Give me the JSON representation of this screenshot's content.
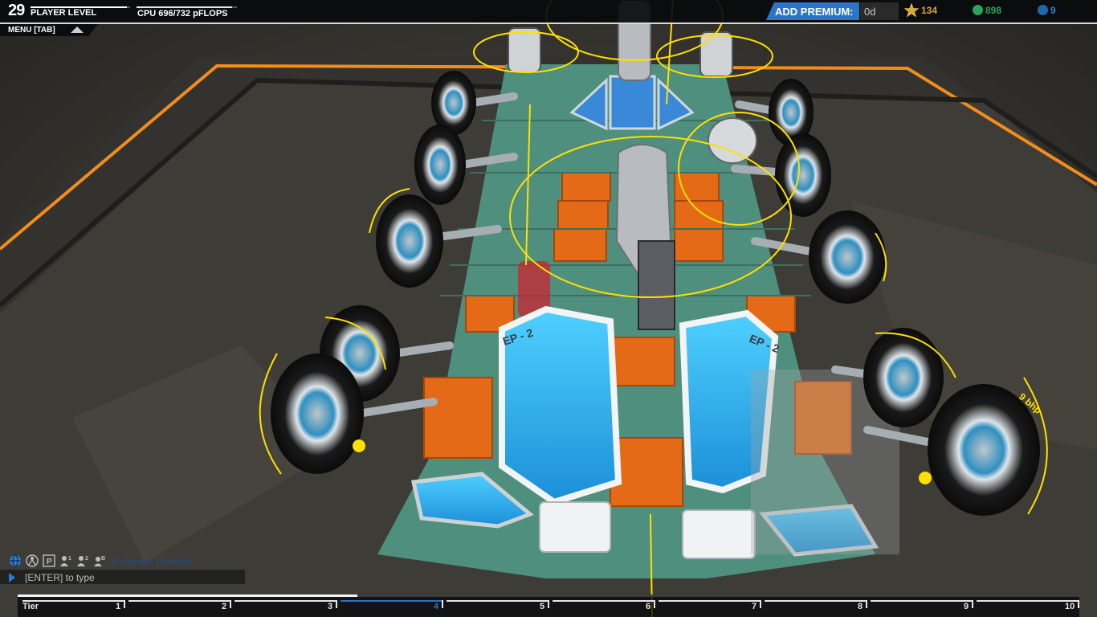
{
  "hud": {
    "level_number": "29",
    "level_label": "PLAYER LEVEL",
    "level_progress": 0.97,
    "cpu_label": "CPU 696/732 pFLOPS",
    "cpu_used": 696,
    "cpu_max": 732,
    "menu_label": "MENU [TAB]",
    "premium_label": "ADD PREMIUM:",
    "premium_value": "0d",
    "stars": "134",
    "robits": "898",
    "cosmetic_credits": "9"
  },
  "colors": {
    "accent_blue": "#2b74c9",
    "star_gold": "#d7a832",
    "robits_green": "#29a35d",
    "credits_blue": "#1d68a8",
    "arena_orange": "#f28c1a",
    "block_teal": "#4f8f7d",
    "block_orange": "#e56a18"
  },
  "chat": {
    "icons": [
      "globe-icon",
      "person-icon",
      "party-icon",
      "team-1-icon",
      "team-2-icon",
      "clan-icon"
    ],
    "team_1_badge": "1",
    "team_2_badge": "2",
    "party_badge": "P",
    "clan_badge": "B",
    "channel": "Everyone (French)",
    "input_placeholder": "[ENTER] to type"
  },
  "tier_bar": {
    "label": "Tier",
    "progress": 0.32,
    "active_tier": "4",
    "tiers": [
      "1",
      "2",
      "3",
      "4",
      "5",
      "6",
      "7",
      "8",
      "9",
      "10"
    ]
  },
  "robot": {
    "module_label_left": "EP - 2",
    "module_label_right": "EP - 2",
    "wheel_power_label": "9 bhp"
  }
}
